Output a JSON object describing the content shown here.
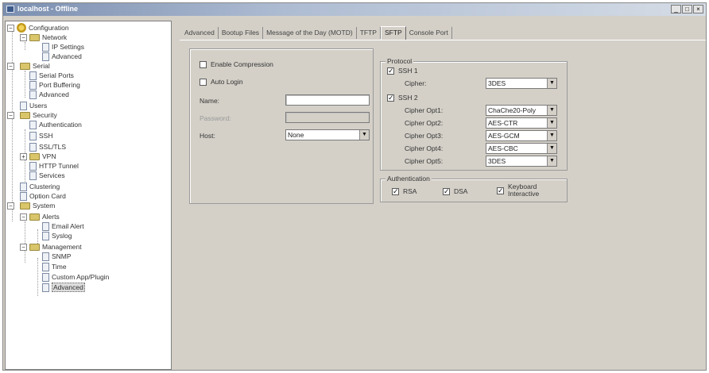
{
  "window": {
    "title": "localhost - Offline",
    "controls": {
      "minimize": "_",
      "maximize": "□",
      "close": "×"
    }
  },
  "tree": {
    "configuration": "Configuration",
    "network": "Network",
    "ip_settings": "IP Settings",
    "network_advanced": "Advanced",
    "serial": "Serial",
    "serial_ports": "Serial Ports",
    "port_buffering": "Port Buffering",
    "serial_advanced": "Advanced",
    "users": "Users",
    "security": "Security",
    "authentication": "Authentication",
    "ssh": "SSH",
    "ssl_tls": "SSL/TLS",
    "vpn": "VPN",
    "http_tunnel": "HTTP Tunnel",
    "services": "Services",
    "clustering": "Clustering",
    "option_card": "Option Card",
    "system": "System",
    "alerts": "Alerts",
    "email_alert": "Email Alert",
    "syslog": "Syslog",
    "management": "Management",
    "snmp": "SNMP",
    "time": "Time",
    "custom_app": "Custom App/Plugin",
    "mgmt_advanced": "Advanced"
  },
  "tabs": [
    "Advanced",
    "Bootup Files",
    "Message of the Day (MOTD)",
    "TFTP",
    "SFTP",
    "Console Port"
  ],
  "left_panel": {
    "enable_compression": "Enable Compression",
    "enable_compression_checked": false,
    "auto_login": "Auto Login",
    "auto_login_checked": false,
    "name_label": "Name:",
    "name_value": "",
    "password_label": "Password:",
    "password_value": "",
    "host_label": "Host:",
    "host_value": "None"
  },
  "protocol": {
    "legend": "Protocol",
    "ssh1_label": "SSH 1",
    "ssh1_checked": true,
    "cipher_label": "Cipher:",
    "cipher_value": "3DES",
    "ssh2_label": "SSH 2",
    "ssh2_checked": true,
    "opts": [
      {
        "label": "Cipher Opt1:",
        "value": "ChaChe20-Poly"
      },
      {
        "label": "Cipher Opt2:",
        "value": "AES-CTR"
      },
      {
        "label": "Cipher Opt3:",
        "value": "AES-GCM"
      },
      {
        "label": "Cipher Opt4:",
        "value": "AES-CBC"
      },
      {
        "label": "Cipher Opt5:",
        "value": "3DES"
      }
    ]
  },
  "authentication": {
    "legend": "Authentication",
    "rsa": "RSA",
    "rsa_checked": true,
    "dsa": "DSA",
    "dsa_checked": true,
    "keyboard_line1": "Keyboard",
    "keyboard_line2": "Interactive",
    "keyboard_checked": true
  },
  "check_mark": "✓",
  "dropdown_arrow": "▼"
}
